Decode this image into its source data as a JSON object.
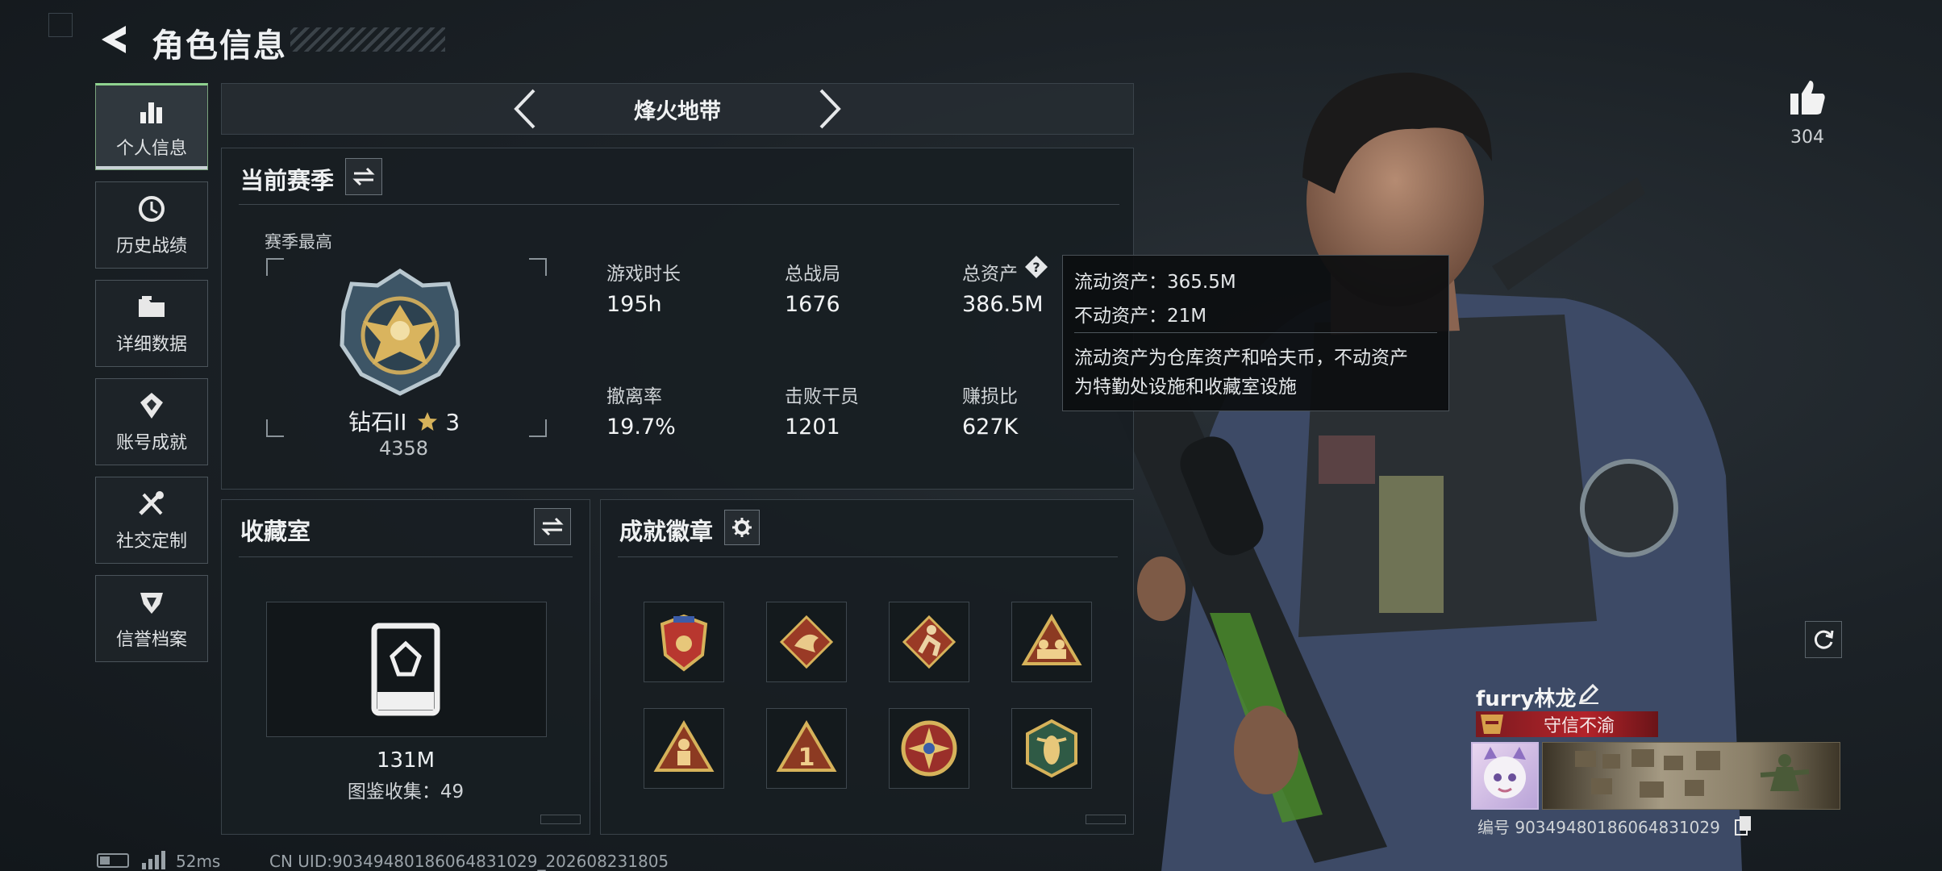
{
  "header": {
    "title": "角色信息"
  },
  "sidebar": {
    "items": [
      {
        "label": "个人信息",
        "icon": "bar-chart-icon",
        "active": true
      },
      {
        "label": "历史战绩",
        "icon": "history-icon"
      },
      {
        "label": "详细数据",
        "icon": "folder-icon"
      },
      {
        "label": "账号成就",
        "icon": "achievement-icon"
      },
      {
        "label": "社交定制",
        "icon": "tools-icon"
      },
      {
        "label": "信誉档案",
        "icon": "credit-icon"
      }
    ]
  },
  "mode": {
    "name": "烽火地带"
  },
  "season": {
    "title": "当前赛季",
    "best_label": "赛季最高",
    "rank_name": "钻石II",
    "rank_stars": "3",
    "rank_points": "4358",
    "stats": [
      {
        "label": "游戏时长",
        "value": "195h"
      },
      {
        "label": "总战局",
        "value": "1676"
      },
      {
        "label": "总资产",
        "value": "386.5M"
      },
      {
        "label": "撤离率",
        "value": "19.7%"
      },
      {
        "label": "击败干员",
        "value": "1201"
      },
      {
        "label": "赚损比",
        "value": "627K"
      }
    ]
  },
  "tooltip": {
    "line1": "流动资产：365.5M",
    "line2": "不动资产：21M",
    "desc1": "流动资产为仓库资产和哈夫币，不动资产",
    "desc2": "为特勤处设施和收藏室设施"
  },
  "collection": {
    "title": "收藏室",
    "value": "131M",
    "count_text": "图鉴收集：49"
  },
  "badges": {
    "title": "成就徽章",
    "items": [
      "shield-badge-icon",
      "dragon-badge-icon",
      "runner-badge-icon",
      "squad-badge-icon",
      "soldier-badge-icon",
      "number-one-badge-icon",
      "star-compass-badge-icon",
      "wasp-badge-icon"
    ]
  },
  "likes": {
    "count": "304"
  },
  "player": {
    "name": "furry林龙",
    "title_tag": "守信不渝",
    "id_text": "编号 9034948018606483102​9"
  },
  "status": {
    "ping": "52ms",
    "uid": "CN UID:9034948018606483102​9_202608231805"
  },
  "colors": {
    "accent_green": "#8fd28f",
    "tag_red": "#b3232a",
    "gold": "#d6b25a"
  }
}
